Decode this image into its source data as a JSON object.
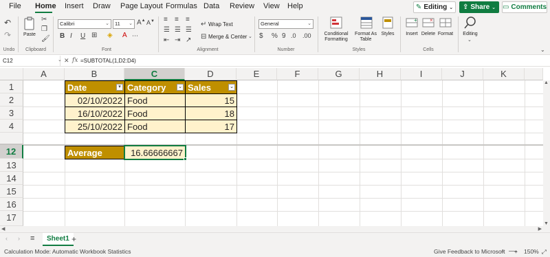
{
  "menu": {
    "tabs": [
      "File",
      "Home",
      "Insert",
      "Draw",
      "Page Layout",
      "Formulas",
      "Data",
      "Review",
      "View",
      "Help"
    ],
    "active": "Home",
    "editing_label": "Editing",
    "share_label": "Share",
    "comments_label": "Comments"
  },
  "ribbon": {
    "undo_label": "Undo",
    "paste_label": "Paste",
    "clipboard_label": "Clipboard",
    "font_name": "Calibri",
    "font_size": "11",
    "font_label": "Font",
    "bold": "B",
    "italic": "I",
    "underline": "U",
    "wrap_text": "Wrap Text",
    "merge_center": "Merge & Center",
    "alignment_label": "Alignment",
    "number_format": "General",
    "number_label": "Number",
    "currency_symbol": "$",
    "percent_symbol": "%",
    "comma_symbol": "9",
    "conditional_formatting": [
      "Conditional",
      "Formatting"
    ],
    "format_as_table": [
      "Format As",
      "Table"
    ],
    "styles_btn": "Styles",
    "styles_label": "Styles",
    "insert": "Insert",
    "delete": "Delete",
    "format": "Format",
    "cells_label": "Cells",
    "editing": "Editing"
  },
  "formula_bar": {
    "name_box": "C12",
    "formula": "=SUBTOTAL(1,D2:D4)",
    "fx": "fx"
  },
  "columns": [
    "A",
    "B",
    "C",
    "D",
    "E",
    "F",
    "G",
    "H",
    "I",
    "J",
    "K"
  ],
  "selected_column": "C",
  "rows": [
    "1",
    "2",
    "3",
    "4",
    "12",
    "13",
    "14",
    "15",
    "16",
    "17"
  ],
  "selected_row": "12",
  "table": {
    "headers": [
      "Date",
      "Category",
      "Sales"
    ],
    "rows": [
      [
        "02/10/2022",
        "Food",
        "15"
      ],
      [
        "16/10/2022",
        "Food",
        "18"
      ],
      [
        "25/10/2022",
        "Food",
        "17"
      ]
    ],
    "average_label": "Average",
    "average_value": "16.66666667"
  },
  "sheets": {
    "tabs": [
      "Sheet1"
    ],
    "add": "+"
  },
  "status": {
    "calc_mode": "Calculation Mode: Automatic",
    "workbook_stats": "Workbook Statistics",
    "feedback": "Give Feedback to Microsoft",
    "zoom": "150%",
    "zoom_minus": "−",
    "zoom_plus": "+"
  },
  "colors": {
    "accent": "#107c41",
    "table_header": "#bf8f00",
    "table_body": "#fff2cc"
  }
}
